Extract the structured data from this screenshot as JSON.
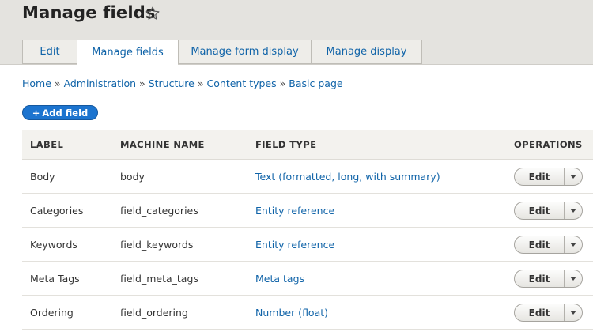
{
  "page": {
    "title": "Manage fields"
  },
  "tabs": [
    {
      "label": "Edit"
    },
    {
      "label": "Manage fields"
    },
    {
      "label": "Manage form display"
    },
    {
      "label": "Manage display"
    }
  ],
  "breadcrumb": [
    "Home",
    "Administration",
    "Structure",
    "Content types",
    "Basic page"
  ],
  "breadcrumb_separator": "»",
  "actions": {
    "add_field_label": "Add field",
    "add_field_prefix": "+"
  },
  "table": {
    "headers": [
      "LABEL",
      "MACHINE NAME",
      "FIELD TYPE",
      "OPERATIONS"
    ],
    "rows": [
      {
        "label": "Body",
        "machine_name": "body",
        "field_type": "Text (formatted, long, with summary)",
        "operation": "Edit"
      },
      {
        "label": "Categories",
        "machine_name": "field_categories",
        "field_type": "Entity reference",
        "operation": "Edit"
      },
      {
        "label": "Keywords",
        "machine_name": "field_keywords",
        "field_type": "Entity reference",
        "operation": "Edit"
      },
      {
        "label": "Meta Tags",
        "machine_name": "field_meta_tags",
        "field_type": "Meta tags",
        "operation": "Edit"
      },
      {
        "label": "Ordering",
        "machine_name": "field_ordering",
        "field_type": "Number (float)",
        "operation": "Edit"
      }
    ]
  },
  "icons": {
    "title_star": "star-outline-icon",
    "dropdown": "chevron-down-icon"
  },
  "colors": {
    "link": "#0f63a8",
    "primary_button": "#1c74cf",
    "header_bg": "#e4e3df"
  }
}
